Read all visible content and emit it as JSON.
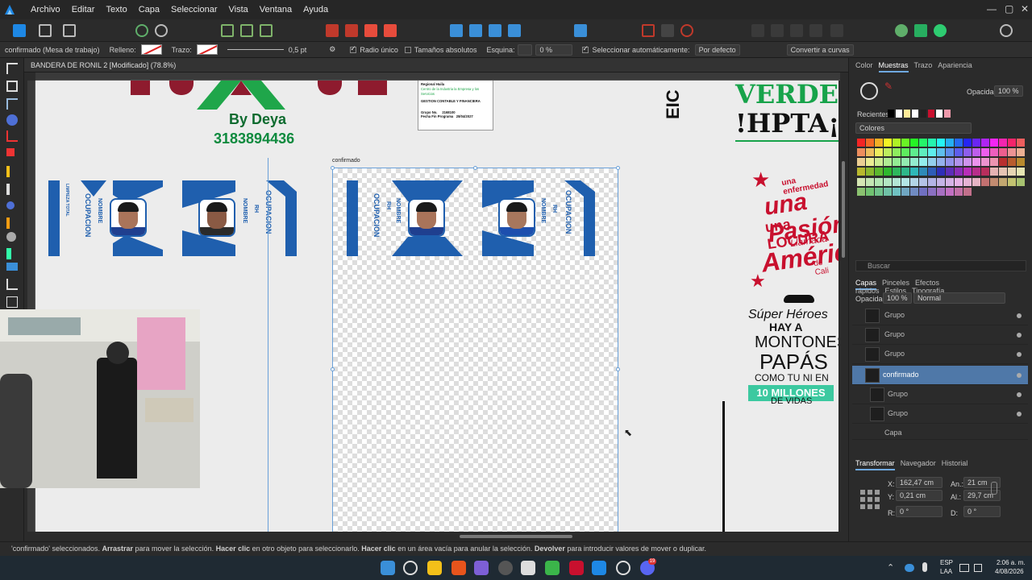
{
  "menubar": {
    "items": [
      "Archivo",
      "Editar",
      "Texto",
      "Capa",
      "Seleccionar",
      "Vista",
      "Ventana",
      "Ayuda"
    ],
    "window_controls": [
      "—",
      "▢",
      "✕"
    ]
  },
  "context": {
    "selection_label": "confirmado (Mesa de trabajo)",
    "fill_label": "Relleno:",
    "stroke_label": "Trazo:",
    "stroke_width": "0,5 pt",
    "radius_label": "Radio único",
    "absolute_sizes_label": "Tamaños absolutos",
    "corner_label": "Esquina:",
    "corner_value": "0 %",
    "auto_select_label": "Seleccionar automáticamente:",
    "auto_select_value": "Por defecto",
    "convert_label": "Convertir a curvas"
  },
  "document": {
    "tab_title": "BANDERA DE RONIL 2 [Modificado] (78.8%)",
    "artboard_label": "confirmado",
    "by_line": "By Deya",
    "phone": "3183894436",
    "form": {
      "l1": "Regional Huila",
      "l2": "Centro de la Industria la Empresa y los Servicios",
      "l3": "GESTION CONTABLE Y FINANCIERA",
      "l4a": "Grupo No.",
      "l4b": "2168100",
      "l5a": "Fecha Fin Programa",
      "l5b": "28/04/2027"
    },
    "card_texts": {
      "nombre": "NOMBRE",
      "rh": "RH",
      "ocupacion": "OCUPACION",
      "servicios": "Servicios Generales",
      "limpieza": "LIMPIEZA TOTAL"
    },
    "right_art": {
      "verde": "VERDE",
      "hpta": "!HPTA¡",
      "l1": "una enfermedad",
      "l2": "una Pasión",
      "l3": "una LOCURA",
      "l4": "Llamada",
      "l5": "América",
      "l6": "de Cali",
      "s1": "Súper Héroes",
      "s2": "HAY A",
      "s3": "MONTONES",
      "s4": "PAPÁS",
      "s5": "COMO TU NI EN",
      "s6": "10 MILLONES",
      "s7": "DE VIDAS"
    }
  },
  "right_panel": {
    "top_tabs": [
      "Color",
      "Muestras",
      "Trazo",
      "Apariencia"
    ],
    "active_top_tab": "Muestras",
    "opacity_label": "Opacidad:",
    "opacity_value": "100 %",
    "recents_label": "Recientes:",
    "palette_name": "Colores",
    "search_placeholder": "Buscar",
    "layer_tabs": [
      "Capas",
      "Pinceles",
      "Efectos rápidos",
      "Estilos",
      "Tipografía"
    ],
    "layers_opacity_label": "Opacidad:",
    "layers_opacity_value": "100 %",
    "blend_mode": "Normal",
    "layers": [
      {
        "name": "Grupo",
        "selected": false
      },
      {
        "name": "Grupo",
        "selected": false
      },
      {
        "name": "Grupo",
        "selected": false
      },
      {
        "name": "confirmado",
        "selected": true
      },
      {
        "name": "Grupo",
        "selected": false
      },
      {
        "name": "Grupo",
        "selected": false
      },
      {
        "name": "Capa",
        "selected": false
      }
    ],
    "transform_tabs": [
      "Transformar",
      "Navegador",
      "Historial"
    ],
    "transform": {
      "x_label": "X:",
      "x": "162,47 cm",
      "y_label": "Y:",
      "y": "0,21 cm",
      "w_label": "An.:",
      "w": "21 cm",
      "h_label": "Al.:",
      "h": "29,7 cm",
      "r_label": "R:",
      "r": "0 °",
      "s_label": "D:",
      "s": "0 °"
    }
  },
  "status": {
    "p1": "'confirmado' seleccionados. ",
    "b1": "Arrastrar",
    "p2": " para mover la selección. ",
    "b2": "Hacer clic",
    "p3": " en otro objeto para seleccionarlo. ",
    "b3": "Hacer clic",
    "p4": " en un área vacía para anular la selección. ",
    "b4": "Devolver",
    "p5": " para introducir valores de mover o duplicar."
  },
  "taskbar": {
    "lang1": "ESP",
    "lang2": "LAA",
    "time": "2:06 a. m.",
    "date": "4/08/2026",
    "badge": "19"
  }
}
